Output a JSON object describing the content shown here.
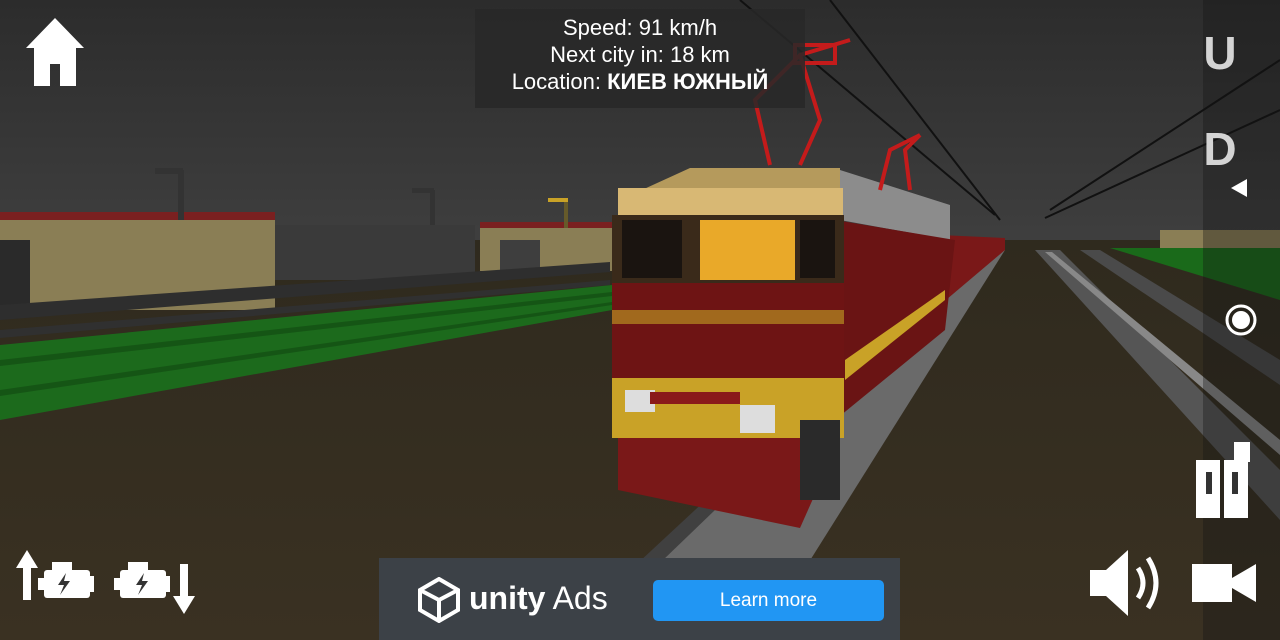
{
  "hud": {
    "speed_label": "Speed:",
    "speed_value": "91 km/h",
    "next_city_label": "Next city in:",
    "next_city_value": "18 km",
    "location_label": "Location:",
    "location_value": "КИЕВ ЮЖНЫЙ"
  },
  "sidebar": {
    "up_label": "U",
    "down_label": "D"
  },
  "ad": {
    "brand_word1": "unity",
    "brand_word2": " Ads",
    "cta": "Learn more"
  },
  "icons": {
    "home": "home-icon",
    "engine_up": "engine-increase-icon",
    "engine_down": "engine-decrease-icon",
    "sound": "speaker-icon",
    "camera": "camera-icon",
    "record": "record-icon",
    "doors": "doors-icon",
    "triangle": "triangle-left-icon"
  },
  "colors": {
    "hud_bg": "#282828",
    "ad_button": "#2196f3",
    "ad_bg": "#3c4147",
    "loco_red": "#6e1414",
    "loco_yellow": "#c9a227",
    "grass": "#1e7a1e"
  }
}
